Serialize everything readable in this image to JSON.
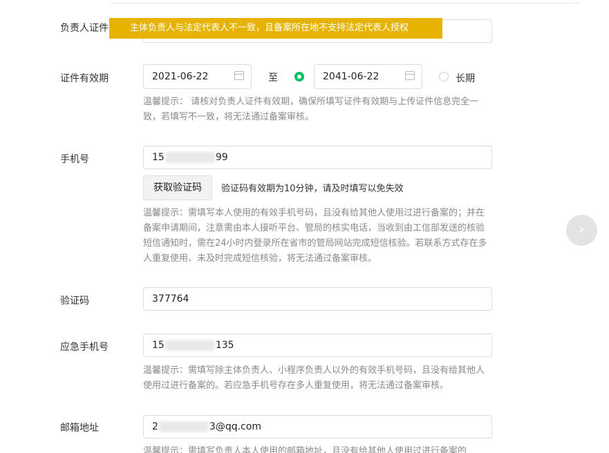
{
  "tooltip": {
    "text": "主体负责人与法定代表人不一致，且备案所在地不支持法定代表人授权"
  },
  "id_holder": {
    "label": "负责人证件"
  },
  "validity": {
    "label": "证件有效期",
    "start": "2021-06-22",
    "to": "至",
    "end": "2041-06-22",
    "long_term": "长期",
    "hint": "温馨提示：  请核对负责人证件有效期，确保所填写证件有效期与上传证件信息完全一致，若填写不一致，将无法通过备案审核。"
  },
  "phone": {
    "label": "手机号",
    "value_prefix": "15",
    "value_suffix": "99",
    "get_code_button": "获取验证码",
    "code_note": "验证码有效期为10分钟，请及时填写以免失效",
    "hint": "温馨提示：需填写本人使用的有效手机号码，且没有给其他人使用过进行备案的；并在备案申请期间，注意需由本人接听平台、管局的核实电话，当收到由工信部发送的核验短信通知时，需在24小时内登录所在省市的管局网站完成短信核验。若联系方式存在多人重复使用、未及时完成短信核验，将无法通过备案审核。"
  },
  "code": {
    "label": "验证码",
    "value": "377764"
  },
  "emergency": {
    "label": "应急手机号",
    "value_prefix": "15",
    "value_suffix": "135",
    "hint": "温馨提示：需填写除主体负责人、小程序负责人以外的有效手机号码，且没有给其他人使用过进行备案的。若应急手机号存在多人重复使用，将无法通过备案审核。"
  },
  "email": {
    "label": "邮箱地址",
    "value_prefix": "2",
    "value_suffix": "3@qq.com",
    "hint": "温馨提示：需填写负责人本人使用的邮箱地址，且没有给其他人使用过进行备案的"
  },
  "icons": {
    "calendar": "calendar-icon",
    "next": "chevron-right-icon"
  },
  "colors": {
    "tooltip_bg": "#e6b400",
    "radio_selected": "#07c160"
  }
}
